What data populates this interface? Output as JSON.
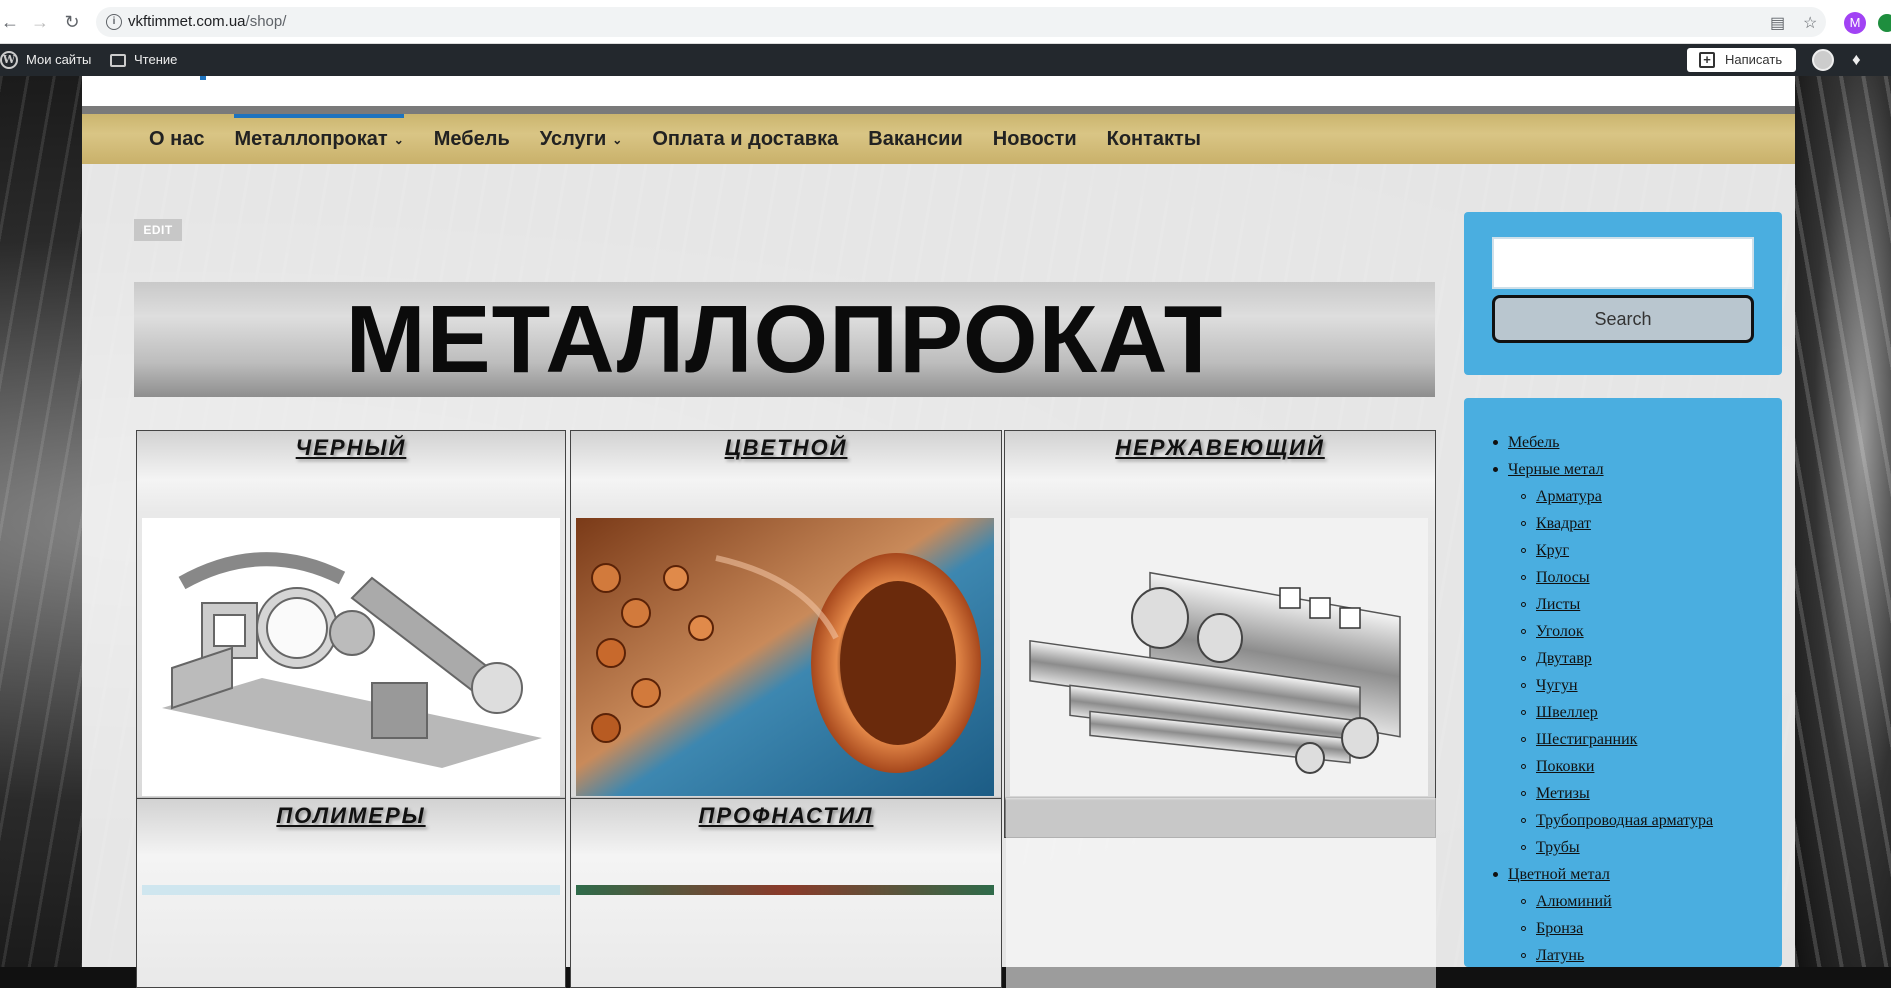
{
  "browser": {
    "url_host": "vkftimmet.com.ua",
    "url_path": "/shop/",
    "profile_initial": "M"
  },
  "adminbar": {
    "my_sites": "Мои сайты",
    "reader": "Чтение",
    "write": "Написать"
  },
  "nav": {
    "items": [
      {
        "label": "О нас",
        "dropdown": false,
        "active": false
      },
      {
        "label": "Металлопрокат",
        "dropdown": true,
        "active": true
      },
      {
        "label": "Мебель",
        "dropdown": false,
        "active": false
      },
      {
        "label": "Услуги",
        "dropdown": true,
        "active": false
      },
      {
        "label": "Оплата и доставка",
        "dropdown": false,
        "active": false
      },
      {
        "label": "Вакансии",
        "dropdown": false,
        "active": false
      },
      {
        "label": "Новости",
        "dropdown": false,
        "active": false
      },
      {
        "label": "Контакты",
        "dropdown": false,
        "active": false
      }
    ]
  },
  "content": {
    "edit_label": "EDIT",
    "banner_title": "МЕТАЛЛОПРОКАТ",
    "cards": [
      {
        "title": "ЧЕРНЫЙ",
        "image": "steel-profiles-image"
      },
      {
        "title": "ЦВЕТНОЙ",
        "image": "copper-pipes-image"
      },
      {
        "title": "НЕРЖАВЕЮЩИЙ",
        "image": "stainless-tubes-image"
      },
      {
        "title": "ПОЛИМЕРЫ",
        "image": "polymers-image"
      },
      {
        "title": "ПРОФНАСТИЛ",
        "image": "profiled-sheet-image"
      }
    ]
  },
  "sidebar": {
    "search_button": "Search",
    "search_value": "",
    "categories": [
      {
        "label": "Мебель",
        "level": 0
      },
      {
        "label": "Черные метал",
        "level": 0
      },
      {
        "label": "Арматура",
        "level": 1
      },
      {
        "label": "Квадрат",
        "level": 1
      },
      {
        "label": "Круг",
        "level": 1
      },
      {
        "label": "Полосы",
        "level": 1
      },
      {
        "label": "Листы",
        "level": 1
      },
      {
        "label": "Уголок",
        "level": 1
      },
      {
        "label": "Двутавр",
        "level": 1
      },
      {
        "label": "Чугун",
        "level": 1
      },
      {
        "label": "Швеллер",
        "level": 1
      },
      {
        "label": "Шестигранник",
        "level": 1
      },
      {
        "label": "Поковки",
        "level": 1
      },
      {
        "label": "Метизы",
        "level": 1
      },
      {
        "label": "Трубопроводная арматура",
        "level": 1
      },
      {
        "label": "Трубы",
        "level": 1
      },
      {
        "label": "Цветной метал",
        "level": 0
      },
      {
        "label": "Алюминий",
        "level": 1
      },
      {
        "label": "Бронза",
        "level": 1
      },
      {
        "label": "Латунь",
        "level": 1
      }
    ]
  },
  "colors": {
    "accent": "#1e73be",
    "sidebar_bg": "#4aaee0",
    "nav_gold": "#d2bd7a",
    "adminbar": "#23282d"
  }
}
